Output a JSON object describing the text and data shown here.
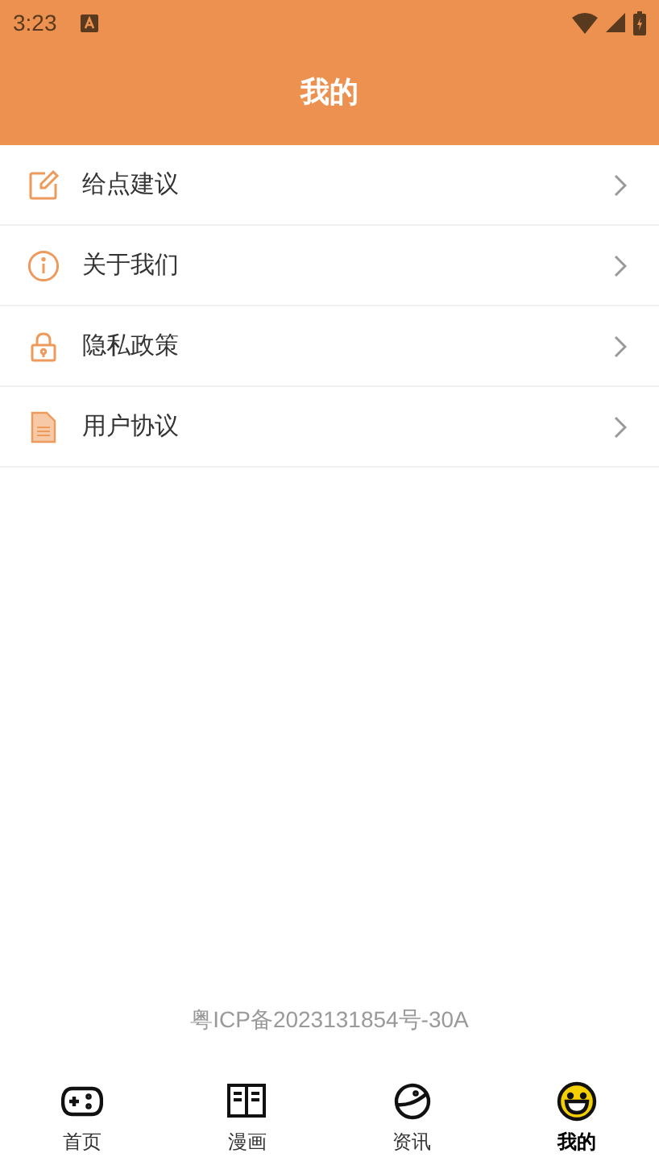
{
  "status_bar": {
    "time": "3:23"
  },
  "header": {
    "title": "我的"
  },
  "menu": [
    {
      "kind": "edit",
      "label": "给点建议"
    },
    {
      "kind": "info",
      "label": "关于我们"
    },
    {
      "kind": "lock",
      "label": "隐私政策"
    },
    {
      "kind": "document",
      "label": "用户协议"
    }
  ],
  "footer": {
    "icp": "粤ICP备2023131854号-30A"
  },
  "nav": [
    {
      "kind": "gamepad",
      "label": "首页",
      "selected": false
    },
    {
      "kind": "book",
      "label": "漫画",
      "selected": false
    },
    {
      "kind": "planet",
      "label": "资讯",
      "selected": false
    },
    {
      "kind": "smiley",
      "label": "我的",
      "selected": true
    }
  ]
}
